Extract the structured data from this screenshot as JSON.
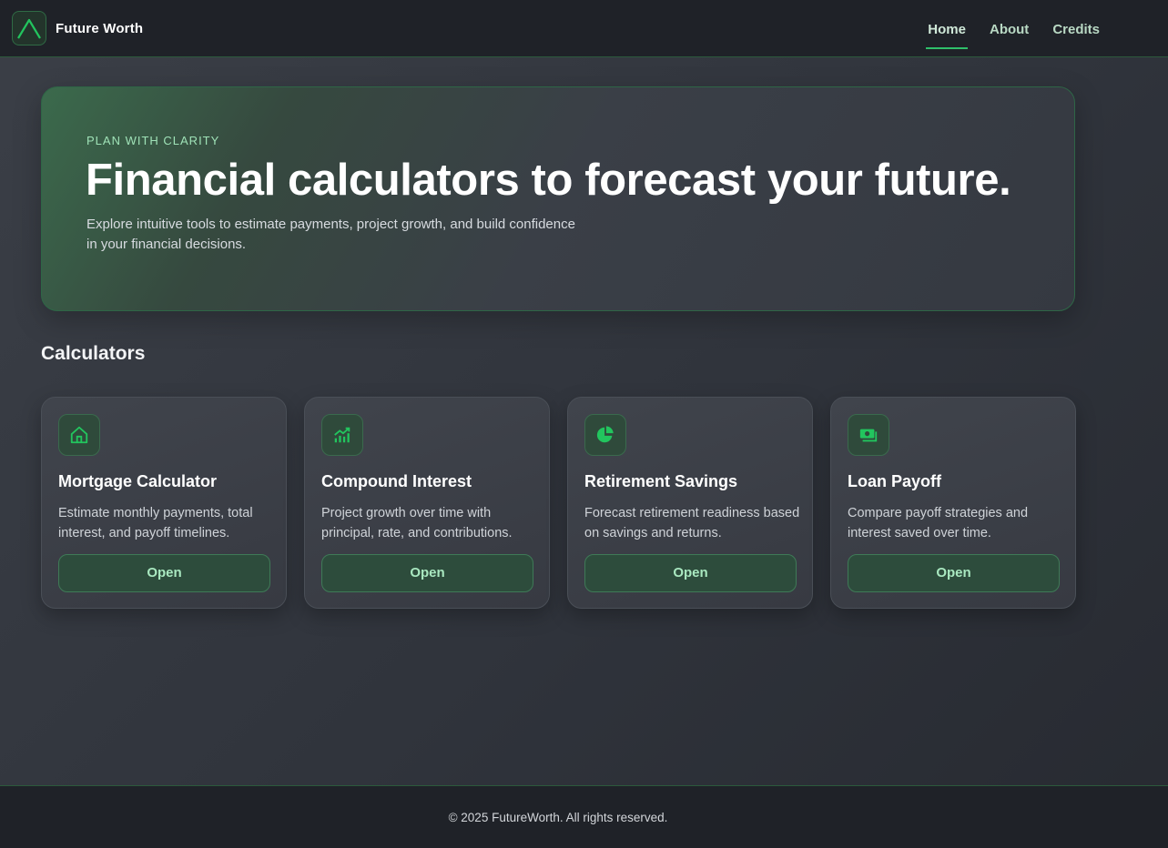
{
  "brand": {
    "name": "Future Worth",
    "logo_icon": "peak-chevron-icon",
    "accent": "#2fbf6a"
  },
  "nav": {
    "items": [
      {
        "label": "Home",
        "active": true
      },
      {
        "label": "About",
        "active": false
      },
      {
        "label": "Credits",
        "active": false
      }
    ]
  },
  "hero": {
    "eyebrow": "PLAN WITH CLARITY",
    "title": "Financial calculators to forecast your future.",
    "subtitle": "Explore intuitive tools to estimate payments, project growth, and build confidence in your financial decisions."
  },
  "calculators": {
    "section_title": "Calculators",
    "cards": [
      {
        "icon": "house-icon",
        "title": "Mortgage Calculator",
        "description": "Estimate monthly payments, total interest, and payoff timelines.",
        "button": "Open"
      },
      {
        "icon": "chart-growth-icon",
        "title": "Compound Interest",
        "description": "Project growth over time with principal, rate, and contributions.",
        "button": "Open"
      },
      {
        "icon": "pie-chart-icon",
        "title": "Retirement Savings",
        "description": "Forecast retirement readiness based on savings and returns.",
        "button": "Open"
      },
      {
        "icon": "money-icon",
        "title": "Loan Payoff",
        "description": "Compare payoff strategies and interest saved over time.",
        "button": "Open"
      }
    ]
  },
  "footer": {
    "text": "© 2025 FutureWorth. All rights reserved."
  }
}
